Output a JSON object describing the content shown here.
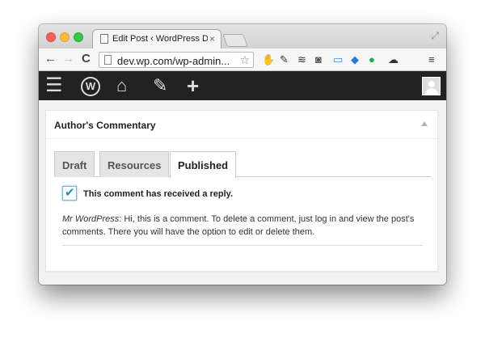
{
  "browser": {
    "tab_title": "Edit Post ‹ WordPress Deve",
    "tab_close": "×",
    "url": "dev.wp.com/wp-admin...",
    "nav": {
      "back": "←",
      "forward": "→",
      "reload": "C"
    },
    "extensions": [
      "evernote-icon",
      "wrench-icon",
      "buffer-icon",
      "pocket-icon",
      "screen-icon",
      "dropbox-icon",
      "green-leaf-icon",
      "cloud-icon",
      "menu-icon"
    ]
  },
  "adminbar": {
    "wp_logo": "W",
    "menu_glyph": "☰",
    "home_glyph": "⌂",
    "comment_glyph": "✎",
    "plus_glyph": "+"
  },
  "metabox": {
    "title": "Author's Commentary",
    "tabs": [
      {
        "label": "Draft",
        "active": false
      },
      {
        "label": "Resources",
        "active": false
      },
      {
        "label": "Published",
        "active": true
      }
    ],
    "checkbox": {
      "checked": true,
      "label": "This comment has received a reply."
    },
    "comment": {
      "author": "Mr WordPress",
      "text": ": Hi, this is a comment. To delete a comment, just log in and view the post's comments. There you will have the option to edit or delete them."
    }
  },
  "colors": {
    "adminbar_bg": "#222222",
    "accent": "#1e8cbe",
    "page_bg": "#f1f1f1"
  }
}
